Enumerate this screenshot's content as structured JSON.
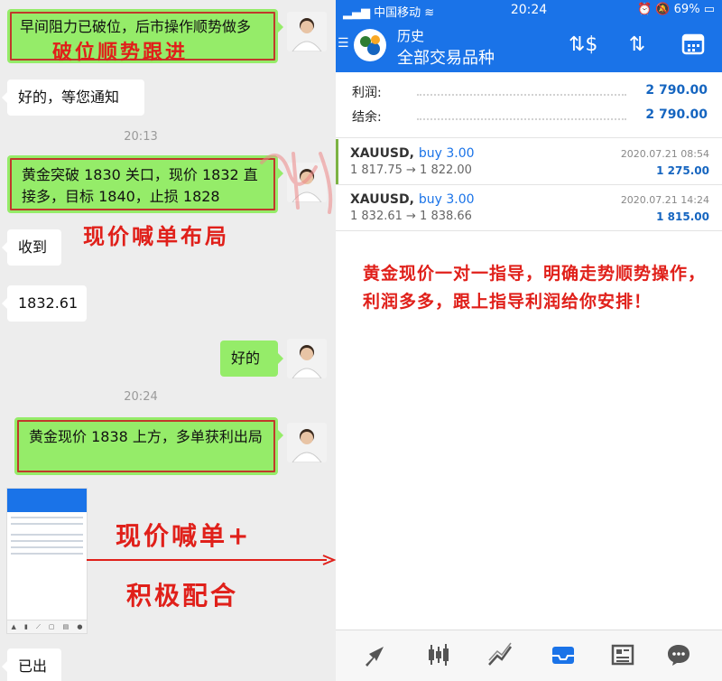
{
  "chat": {
    "messages": [
      {
        "text": "早间阻力已破位，后市操作顺势做多"
      },
      {
        "text": "好的，等您通知"
      },
      {
        "text": "黄金突破 1830 关口，现价 1832 直接多，目标 1840，止损 1828"
      },
      {
        "text": "收到"
      },
      {
        "text": "1832.61"
      },
      {
        "text": "好的"
      },
      {
        "text": "黄金现价 1838 上方，多单获利出局"
      },
      {
        "text": "已出"
      }
    ],
    "times": [
      "20:13",
      "20:24"
    ],
    "annotations": {
      "a1": "破位顺势跟进",
      "a2": "现价喊单布局",
      "a3": "现价喊单+",
      "a4": "积极配合"
    }
  },
  "app": {
    "status": {
      "carrier": "中国移动",
      "time": "20:24",
      "battery": "69%"
    },
    "title": "历史",
    "subtitle": "全部交易品种",
    "summary": {
      "profit_label": "利润:",
      "profit_value": "2 790.00",
      "balance_label": "结余:",
      "balance_value": "2 790.00"
    },
    "trades": [
      {
        "symbol": "XAUUSD,",
        "direction": "buy 3.00",
        "prices": "1 817.75 → 1 822.00",
        "date": "2020.07.21 08:54",
        "profit": "1 275.00"
      },
      {
        "symbol": "XAUUSD,",
        "direction": "buy 3.00",
        "prices": "1 832.61 → 1 838.66",
        "date": "2020.07.21 14:24",
        "profit": "1 815.00"
      }
    ],
    "promo": "黄金现价一对一指导，明确走势顺势操作，利润多多，跟上指导利润给你安排！",
    "tabs": [
      {
        "icon": "trade-arrow-icon"
      },
      {
        "icon": "candlestick-icon"
      },
      {
        "icon": "line-chart-icon"
      },
      {
        "icon": "inbox-icon",
        "active": true
      },
      {
        "icon": "news-icon"
      },
      {
        "icon": "chat-bubble-icon"
      }
    ]
  },
  "colors": {
    "accent": "#1a73e8",
    "bubble_out": "#95ec69",
    "annotation": "#e0201a"
  }
}
